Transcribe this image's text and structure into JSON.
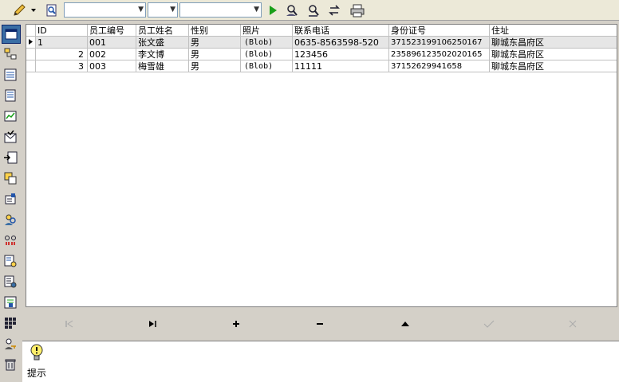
{
  "toolbar": {
    "combo1_value": "",
    "combo2_value": "",
    "combo3_value": ""
  },
  "grid": {
    "columns": [
      "ID",
      "员工编号",
      "员工姓名",
      "性别",
      "照片",
      "联系电话",
      "身份证号",
      "住址"
    ],
    "rows": [
      [
        "1",
        "001",
        "张文盛",
        "男",
        "(Blob)",
        "0635-8563598-520",
        "371523199106250167",
        "聊城东昌府区"
      ],
      [
        "2",
        "002",
        "李文博",
        "男",
        "(Blob)",
        "123456",
        "235896123502020165",
        "聊城东昌府区"
      ],
      [
        "3",
        "003",
        "梅雪雄",
        "男",
        "(Blob)",
        "11111",
        "37152629941658",
        "聊城东昌府区"
      ]
    ]
  },
  "hint": {
    "label": "提示"
  },
  "colors": {
    "accent": "#0a246a",
    "toolbar_bg": "#ece9d8",
    "panel_bg": "#d4d0c8"
  }
}
